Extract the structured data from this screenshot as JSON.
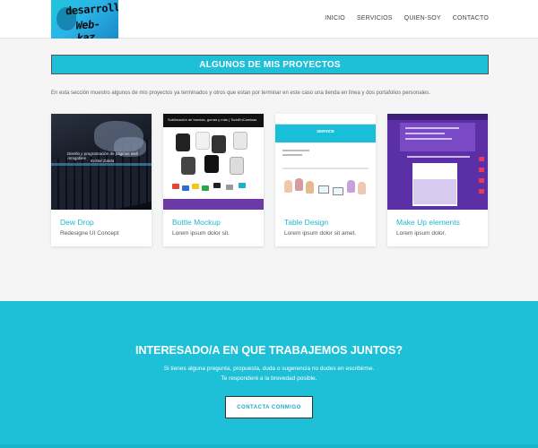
{
  "logo": {
    "line1": "desarrollo",
    "line2": "Web-kaz"
  },
  "nav": {
    "items": [
      {
        "label": "INICIO"
      },
      {
        "label": "SERVICIOS"
      },
      {
        "label": "QUIEN-SOY"
      },
      {
        "label": "CONTACTO"
      }
    ]
  },
  "projects": {
    "title": "ALGUNOS DE MIS PROYECTOS",
    "intro": "En esta sección muestro algunos de mis proyectos ya terminados y otros que estan por terminar en este caso una tienda en línea y dos portafolios personales.",
    "cards": [
      {
        "title": "Dew Drop",
        "subtitle": "Redesigne UI Concept",
        "thumb_text": [
          "Diseño y programación de páginas web Amigables",
          "Kristel Zuleta"
        ]
      },
      {
        "title": "Bottle Mockup",
        "subtitle": "Lorem ipsum dolor sit.",
        "thumb_text": [
          "Sublimación de bandas, gorras y más | TodoEnCamisas"
        ]
      },
      {
        "title": "Table Design",
        "subtitle": "Lorem ipsum dolor sit amet.",
        "thumb_text": [
          "SERVICE"
        ]
      },
      {
        "title": "Make Up elements",
        "subtitle": "Lorem ipsum dolor."
      }
    ]
  },
  "cta": {
    "title": "INTERESADO/A EN QUE TRABAJEMOS JUNTOS?",
    "line1": "Si tienes alguna pregunta, propuesta, duda o sugerencia no dudes en escribirme.",
    "line2": "Te responderé a la brevedad posible.",
    "button": "CONTACTA CONMIGO"
  },
  "colors": {
    "accent": "#1ec0d8",
    "card_title": "#1fb7cf",
    "purple": "#5b2fa6"
  }
}
